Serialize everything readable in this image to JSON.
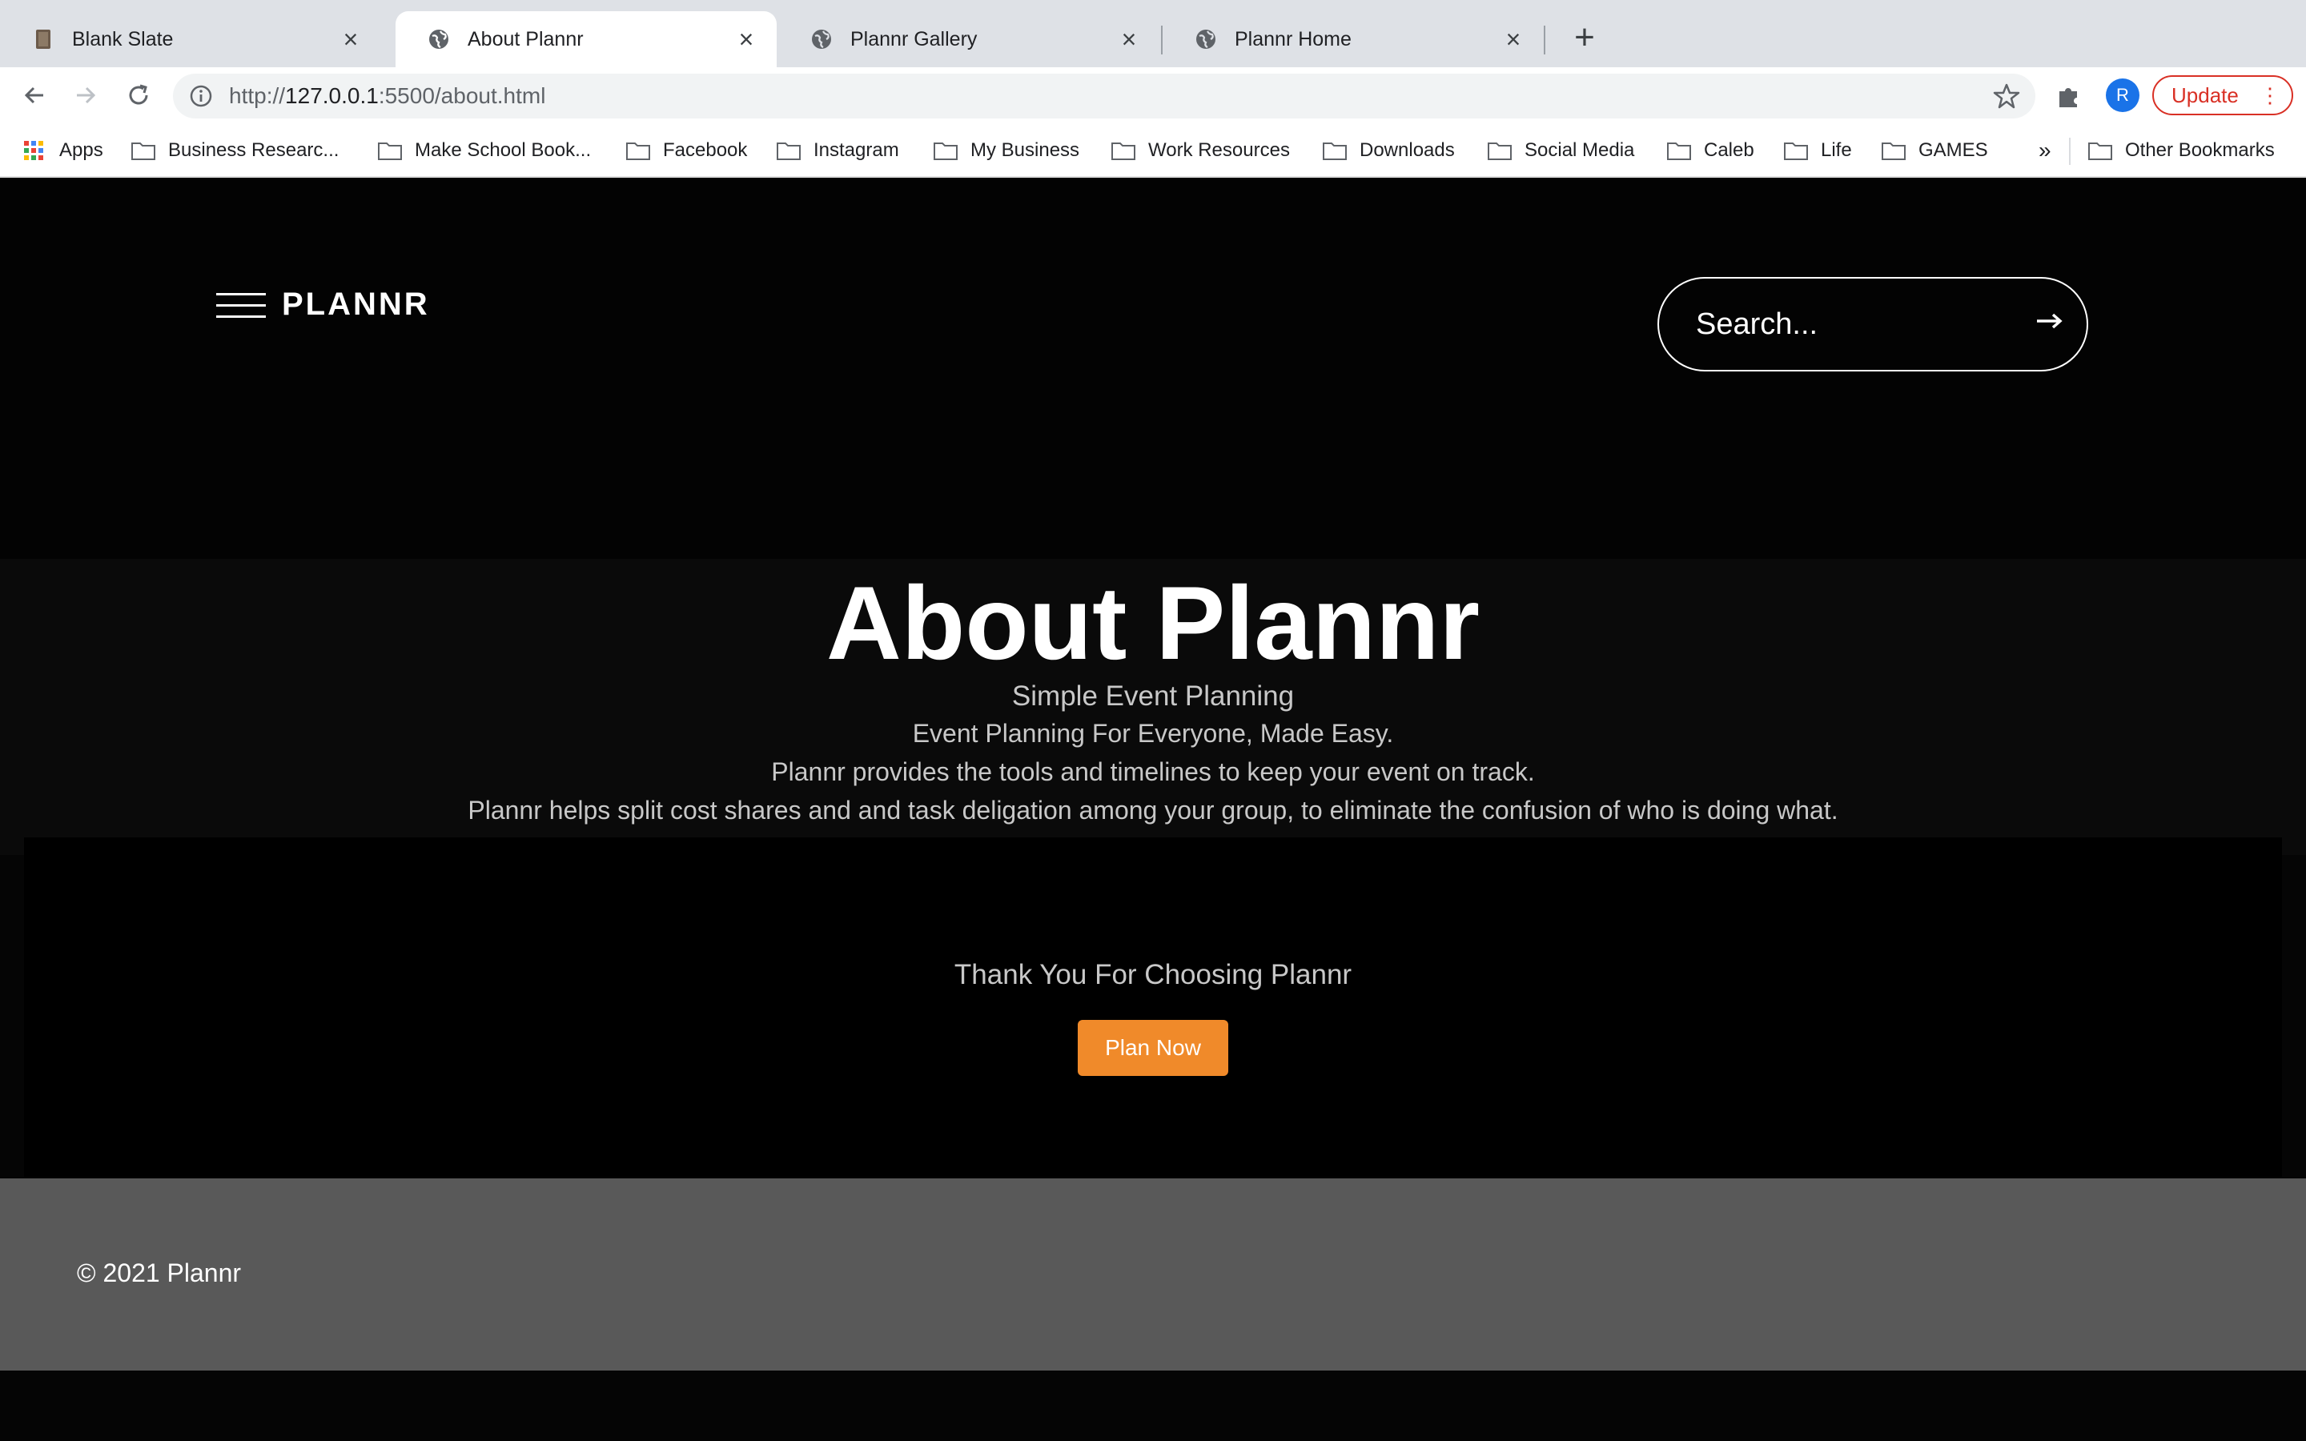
{
  "browser": {
    "tabs": [
      {
        "title": "Blank Slate",
        "icon": "book-favicon",
        "active": false
      },
      {
        "title": "About Plannr",
        "icon": "globe-icon",
        "active": true
      },
      {
        "title": "Plannr Gallery",
        "icon": "globe-icon",
        "active": false
      },
      {
        "title": "Plannr Home",
        "icon": "globe-icon",
        "active": false
      }
    ],
    "new_tab": "+",
    "url_prefix": "http://",
    "url_host": "127.0.0.1",
    "url_rest": ":5500/about.html",
    "profile_initial": "R",
    "update_label": "Update",
    "bookmarks": [
      "Apps",
      "Business Researc...",
      "Make School Book...",
      "Facebook",
      "Instagram",
      "My Business",
      "Work Resources",
      "Downloads",
      "Social Media",
      "Caleb",
      "Life",
      "GAMES"
    ],
    "bookmarks_overflow": "»",
    "other_bookmarks": "Other Bookmarks"
  },
  "header": {
    "brand": "PLANNR",
    "search_placeholder": "Search..."
  },
  "about": {
    "title": "About Plannr",
    "subtitle": "Simple Event Planning",
    "line1": "Event Planning For Everyone, Made Easy.",
    "line2": "Plannr provides the tools and timelines to keep your event on track.",
    "line3": "Plannr helps split cost shares and and task deligation among your group, to eliminate the confusion of who is doing what."
  },
  "cta": {
    "thanks": "Thank You For Choosing Plannr",
    "button": "Plan Now"
  },
  "footer": {
    "copyright": "© 2021 Plannr"
  },
  "colors": {
    "accent": "#f08a2a",
    "footer_bg": "#595959",
    "update_red": "#d93025",
    "avatar_blue": "#1a73e8"
  }
}
